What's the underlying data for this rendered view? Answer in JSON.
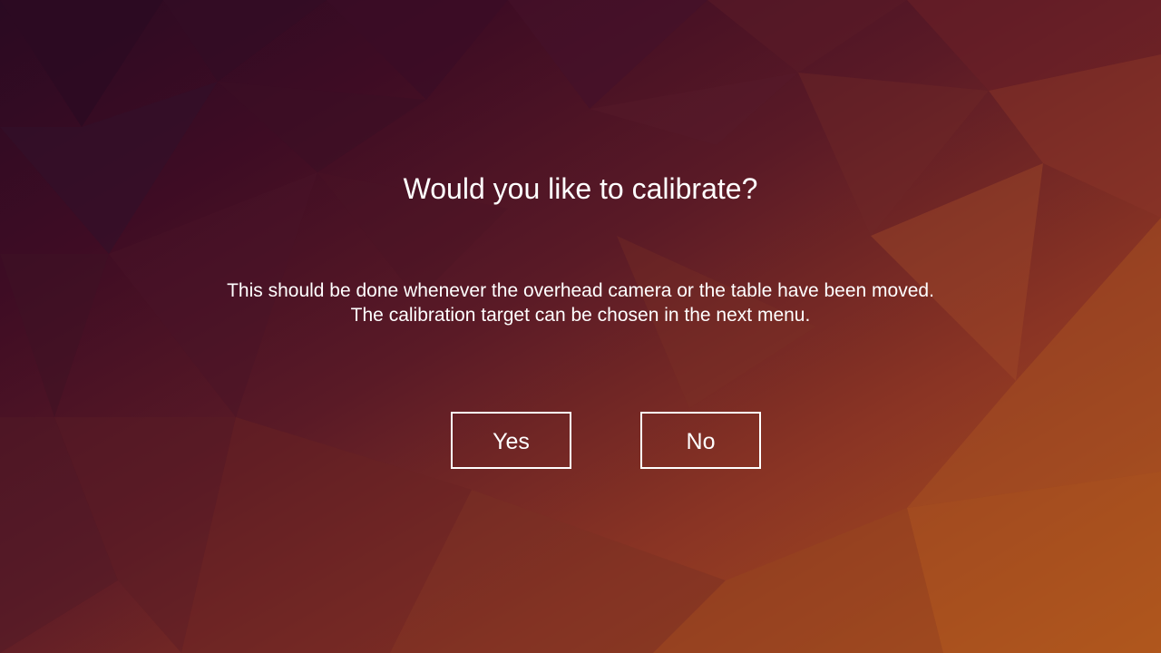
{
  "dialog": {
    "title": "Would you like to calibrate?",
    "description_lines": [
      "This should be done whenever the overhead camera or the table have been moved.",
      "The calibration target can be chosen in the next menu."
    ],
    "yes_label": "Yes",
    "no_label": "No"
  },
  "colors": {
    "text": "#ffffff",
    "button_border": "#ffffff",
    "background_dark": "#2a0a22",
    "background_mid": "#5a1a26",
    "background_warm": "#b0561c"
  }
}
